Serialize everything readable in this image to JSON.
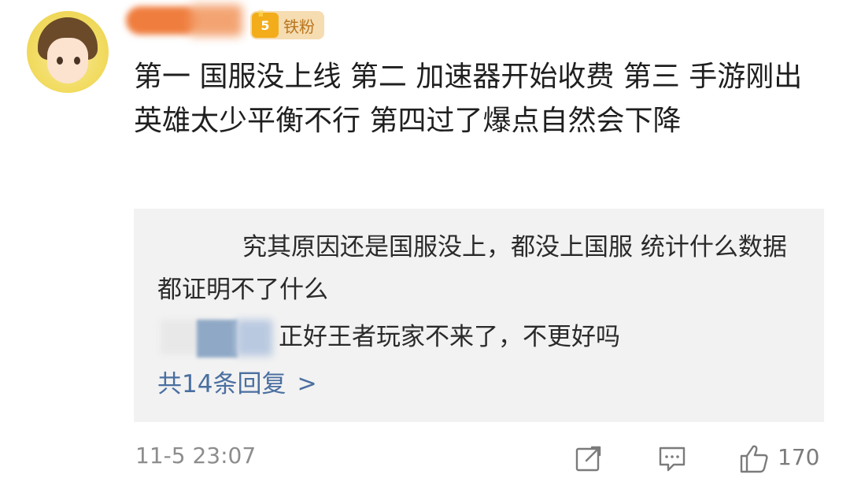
{
  "user": {
    "badge_level": "5",
    "badge_label": "铁粉"
  },
  "comment": {
    "text": "第一 国服没上线 第二 加速器开始收费 第三 手游刚出英雄太少平衡不行 第四过了爆点自然会下降"
  },
  "replies": [
    {
      "text": "究其原因还是国服没上，都没上国服 统计什么数据 都证明不了什么"
    },
    {
      "text": "正好王者玩家不来了，不更好吗"
    }
  ],
  "more_replies": {
    "label": "共14条回复",
    "chevron": ">"
  },
  "footer": {
    "timestamp": "11-5 23:07",
    "share_icon": "share-icon",
    "comment_icon": "comment-icon",
    "like_icon": "like-icon",
    "like_count": "170"
  }
}
